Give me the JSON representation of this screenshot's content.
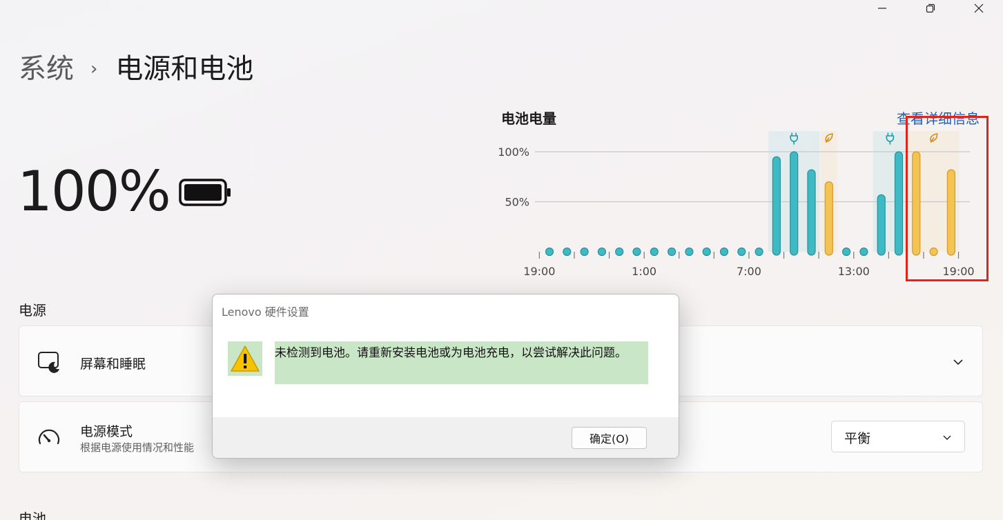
{
  "breadcrumb": {
    "parent": "系统",
    "separator": "›",
    "current": "电源和电池"
  },
  "battery": {
    "percent_text": "100%",
    "level": 1.0
  },
  "usage": {
    "title": "电池电量",
    "details_link": "查看详细信息",
    "chart_data": {
      "type": "bar",
      "title": "电池电量",
      "y_ticks": [
        "100%",
        "50%"
      ],
      "ylim": [
        0,
        100
      ],
      "x_ticks": [
        "19:00",
        "1:00",
        "7:00",
        "13:00",
        "19:00"
      ],
      "legend_icons": [
        "plug-icon",
        "leaf-icon"
      ],
      "colors": {
        "charging": "#3fbac4",
        "saver": "#f3c354"
      },
      "bars": [
        {
          "value": 0,
          "state": "charging"
        },
        {
          "value": 0,
          "state": "charging"
        },
        {
          "value": 0,
          "state": "charging"
        },
        {
          "value": 0,
          "state": "charging"
        },
        {
          "value": 0,
          "state": "charging"
        },
        {
          "value": 0,
          "state": "charging"
        },
        {
          "value": 0,
          "state": "charging"
        },
        {
          "value": 0,
          "state": "charging"
        },
        {
          "value": 0,
          "state": "charging"
        },
        {
          "value": 0,
          "state": "charging"
        },
        {
          "value": 0,
          "state": "charging"
        },
        {
          "value": 0,
          "state": "charging"
        },
        {
          "value": 0,
          "state": "charging"
        },
        {
          "value": 95,
          "state": "charging"
        },
        {
          "value": 100,
          "state": "charging"
        },
        {
          "value": 82,
          "state": "charging"
        },
        {
          "value": 70,
          "state": "saver"
        },
        {
          "value": 0,
          "state": "charging"
        },
        {
          "value": 0,
          "state": "charging"
        },
        {
          "value": 57,
          "state": "charging"
        },
        {
          "value": 100,
          "state": "charging"
        },
        {
          "value": 100,
          "state": "saver"
        },
        {
          "value": 0,
          "state": "saver"
        },
        {
          "value": 82,
          "state": "saver"
        }
      ],
      "bands": [
        {
          "from": 13,
          "to": 15,
          "state": "charging"
        },
        {
          "from": 16,
          "to": 16,
          "state": "saver"
        },
        {
          "from": 19,
          "to": 20,
          "state": "charging"
        },
        {
          "from": 21,
          "to": 23,
          "state": "saver"
        }
      ]
    }
  },
  "power_section": {
    "label": "电源",
    "screen_sleep": {
      "title": "屏幕和睡眠"
    },
    "power_mode": {
      "title": "电源模式",
      "subtitle": "根据电源使用情况和性能",
      "value": "平衡"
    }
  },
  "battery_section": {
    "label": "电池"
  },
  "dialog": {
    "title": "Lenovo 硬件设置",
    "message": "未检测到电池。请重新安装电池或为电池充电，以尝试解决此问题。",
    "ok_label": "确定(O)"
  }
}
